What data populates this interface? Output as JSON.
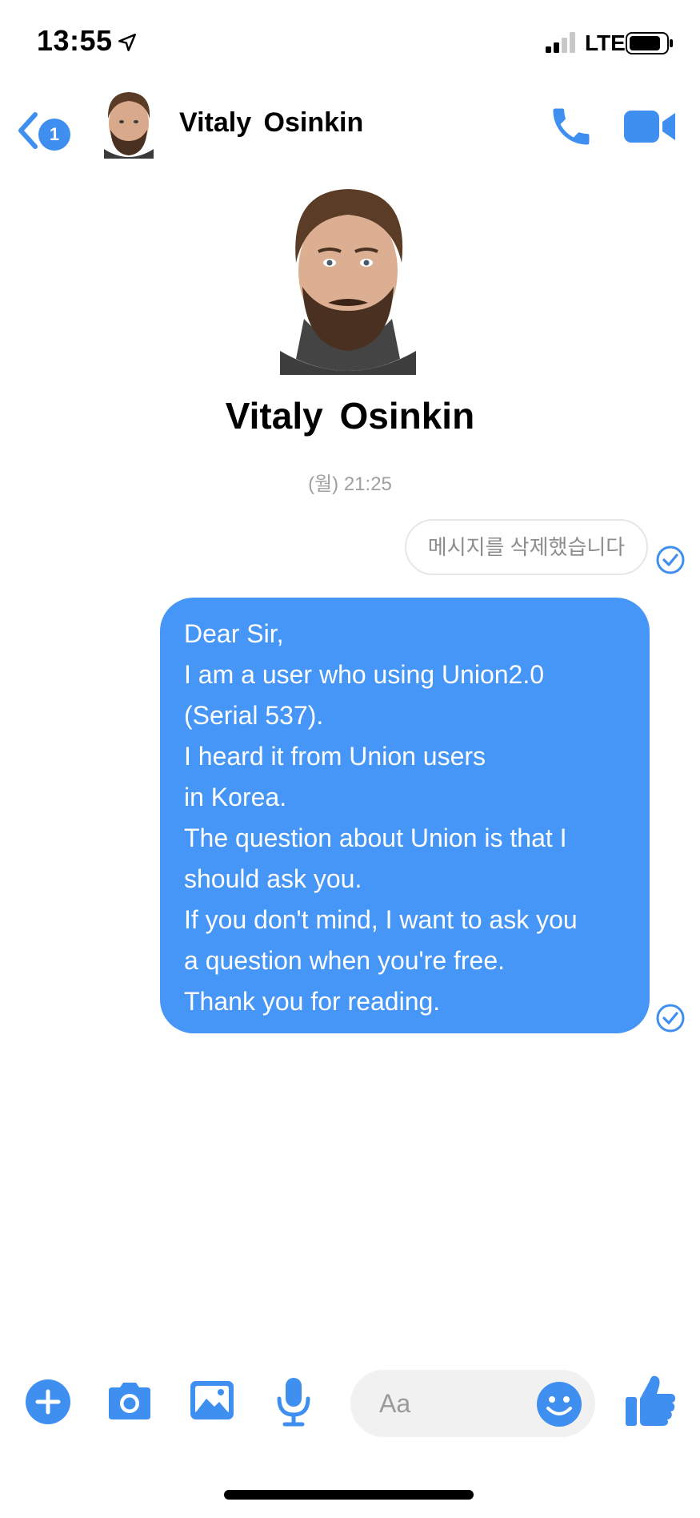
{
  "status_bar": {
    "time": "13:55",
    "network": "LTE",
    "icons": [
      "location-arrow-icon",
      "signal-bars-icon",
      "battery-icon"
    ]
  },
  "header": {
    "back_badge": "1",
    "contact_name": "Vitaly  Osinkin",
    "icons": [
      "back-chevron-icon",
      "phone-icon",
      "video-camera-icon"
    ]
  },
  "profile": {
    "name": "Vitaly  Osinkin"
  },
  "conversation": {
    "timestamp": "(월) 21:25",
    "deleted_message": "메시지를 삭제했습니다",
    "message_lines": [
      "Dear Sir,",
      "I am a user who using Union2.0",
      "(Serial 537).",
      "I heard it from Union users",
      "in Korea.",
      "The question about Union is that I",
      "should ask you.",
      "If you don't mind, I want to ask you",
      "a question when you're free.",
      "Thank you for reading."
    ]
  },
  "composer": {
    "placeholder": "Aa",
    "icons": [
      "plus-icon",
      "camera-icon",
      "image-icon",
      "microphone-icon",
      "emoji-icon",
      "thumbs-up-icon"
    ]
  },
  "colors": {
    "accent": "#3f8ff0",
    "bubble": "#4596f6",
    "meta_text": "#a0a0a0"
  }
}
